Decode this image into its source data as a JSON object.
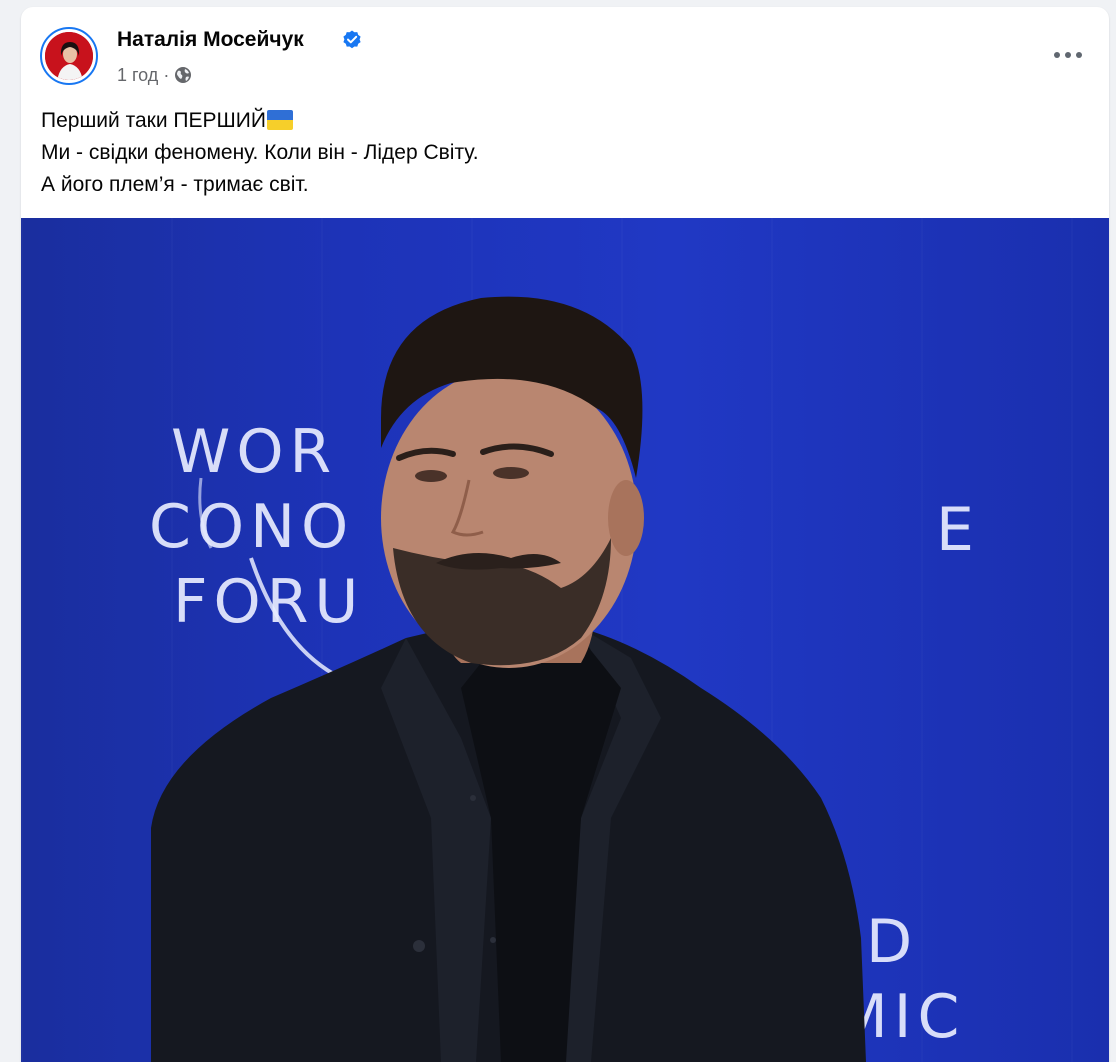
{
  "post": {
    "author": "Наталія Мосейчук",
    "time": "1 год",
    "separator": "·",
    "privacy_icon": "globe-icon",
    "verified_icon": "verified-badge-icon",
    "more_icon": "more-horizontal-icon",
    "text_lines": [
      "Перший таки ПЕРШИЙ",
      "Ми - свідки феномену. Коли він - Лідер Світу.",
      "А його плем’я - тримає світ."
    ],
    "flag_emoji": "flag-ukraine-icon"
  },
  "media": {
    "background_text": {
      "left_lines": [
        "WOR",
        "CONO",
        "FORU"
      ],
      "right_top": "E",
      "right_bottom_lines": [
        "D",
        "MIC"
      ]
    }
  },
  "colors": {
    "accent": "#1877f2",
    "text_primary": "#050505",
    "text_secondary": "#65676b",
    "media_background": "#1d33b8"
  }
}
